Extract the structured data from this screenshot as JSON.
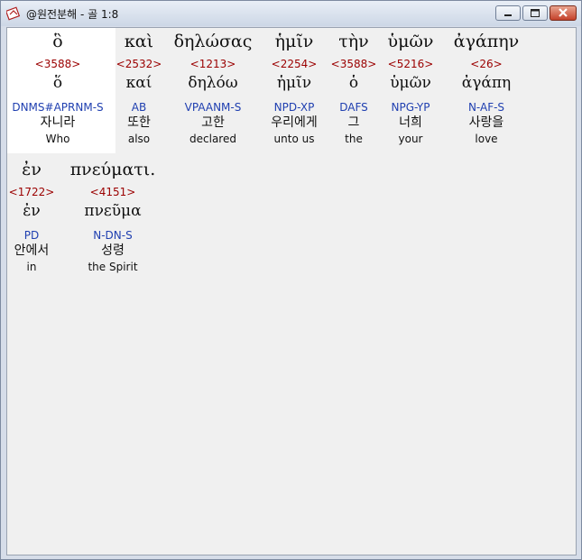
{
  "window": {
    "title": "@원전분해 - 골 1:8",
    "controls": {
      "minimize": "minimize-button",
      "maximize": "maximize-button",
      "close": "close-button"
    }
  },
  "verse": {
    "words": [
      {
        "greek": "ὃ",
        "strong": "<3588>",
        "lemma": "ὅ",
        "parse": "DNMS#APRNM-S",
        "korean": "자니라",
        "english": "Who"
      },
      {
        "greek": "καὶ",
        "strong": "<2532>",
        "lemma": "καί",
        "parse": "AB",
        "korean": "또한",
        "english": "also"
      },
      {
        "greek": "δηλώσας",
        "strong": "<1213>",
        "lemma": "δηλόω",
        "parse": "VPAANM-S",
        "korean": "고한",
        "english": "declared"
      },
      {
        "greek": "ἡμῖν",
        "strong": "<2254>",
        "lemma": "ἡμῖν",
        "parse": "NPD-XP",
        "korean": "우리에게",
        "english": "unto us"
      },
      {
        "greek": "τὴν",
        "strong": "<3588>",
        "lemma": "ὁ",
        "parse": "DAFS",
        "korean": "그",
        "english": "the"
      },
      {
        "greek": "ὑμῶν",
        "strong": "<5216>",
        "lemma": "ὑμῶν",
        "parse": "NPG-YP",
        "korean": "너희",
        "english": "your"
      },
      {
        "greek": "ἀγάπην",
        "strong": "<26>",
        "lemma": "ἀγάπη",
        "parse": "N-AF-S",
        "korean": "사랑을",
        "english": "love"
      },
      {
        "greek": "ἐν",
        "strong": "<1722>",
        "lemma": "ἐν",
        "parse": "PD",
        "korean": "안에서",
        "english": "in"
      },
      {
        "greek": "πνεύματι.",
        "strong": "<4151>",
        "lemma": "πνεῦμα",
        "parse": "N-DN-S",
        "korean": "성령",
        "english": "the Spirit"
      }
    ]
  }
}
